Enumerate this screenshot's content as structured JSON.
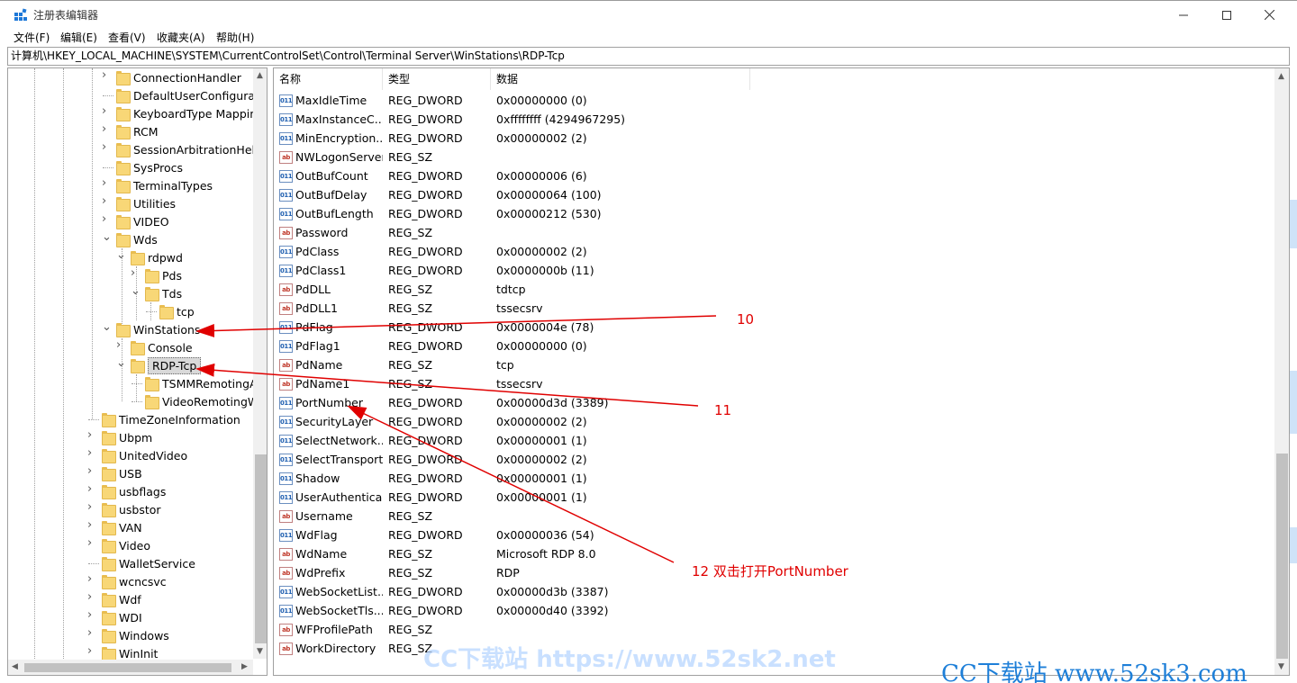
{
  "window": {
    "title": "注册表编辑器",
    "minimize_icon": "minimize-icon",
    "maximize_icon": "maximize-icon",
    "close_icon": "close-icon"
  },
  "menu": {
    "file": "文件(F)",
    "edit": "编辑(E)",
    "view": "查看(V)",
    "favorites": "收藏夹(A)",
    "help": "帮助(H)"
  },
  "address": "计算机\\HKEY_LOCAL_MACHINE\\SYSTEM\\CurrentControlSet\\Control\\Terminal Server\\WinStations\\RDP-Tcp",
  "tree": {
    "items": [
      {
        "label": "ConnectionHandler"
      },
      {
        "label": "DefaultUserConfiguration"
      },
      {
        "label": "KeyboardType Mapping"
      },
      {
        "label": "RCM"
      },
      {
        "label": "SessionArbitrationHelper"
      },
      {
        "label": "SysProcs"
      },
      {
        "label": "TerminalTypes"
      },
      {
        "label": "Utilities"
      },
      {
        "label": "VIDEO"
      },
      {
        "label": "Wds"
      },
      {
        "label": "rdpwd"
      },
      {
        "label": "Pds"
      },
      {
        "label": "Tds"
      },
      {
        "label": "tcp"
      },
      {
        "label": "WinStations"
      },
      {
        "label": "Console"
      },
      {
        "label": "RDP-Tcp"
      },
      {
        "label": "TSMMRemotingAllowedApps"
      },
      {
        "label": "VideoRemotingWindowNames"
      },
      {
        "label": "TimeZoneInformation"
      },
      {
        "label": "Ubpm"
      },
      {
        "label": "UnitedVideo"
      },
      {
        "label": "USB"
      },
      {
        "label": "usbflags"
      },
      {
        "label": "usbstor"
      },
      {
        "label": "VAN"
      },
      {
        "label": "Video"
      },
      {
        "label": "WalletService"
      },
      {
        "label": "wcncsvc"
      },
      {
        "label": "Wdf"
      },
      {
        "label": "WDI"
      },
      {
        "label": "Windows"
      },
      {
        "label": "WinInit"
      }
    ]
  },
  "list": {
    "headers": {
      "name": "名称",
      "type": "类型",
      "data": "数据"
    },
    "rows": [
      {
        "icon": "dword",
        "name": "MaxIdleTime",
        "type": "REG_DWORD",
        "data": "0x00000000 (0)"
      },
      {
        "icon": "dword",
        "name": "MaxInstanceC...",
        "type": "REG_DWORD",
        "data": "0xffffffff (4294967295)"
      },
      {
        "icon": "dword",
        "name": "MinEncryption...",
        "type": "REG_DWORD",
        "data": "0x00000002 (2)"
      },
      {
        "icon": "sz",
        "name": "NWLogonServer",
        "type": "REG_SZ",
        "data": ""
      },
      {
        "icon": "dword",
        "name": "OutBufCount",
        "type": "REG_DWORD",
        "data": "0x00000006 (6)"
      },
      {
        "icon": "dword",
        "name": "OutBufDelay",
        "type": "REG_DWORD",
        "data": "0x00000064 (100)"
      },
      {
        "icon": "dword",
        "name": "OutBufLength",
        "type": "REG_DWORD",
        "data": "0x00000212 (530)"
      },
      {
        "icon": "sz",
        "name": "Password",
        "type": "REG_SZ",
        "data": ""
      },
      {
        "icon": "dword",
        "name": "PdClass",
        "type": "REG_DWORD",
        "data": "0x00000002 (2)"
      },
      {
        "icon": "dword",
        "name": "PdClass1",
        "type": "REG_DWORD",
        "data": "0x0000000b (11)"
      },
      {
        "icon": "sz",
        "name": "PdDLL",
        "type": "REG_SZ",
        "data": "tdtcp"
      },
      {
        "icon": "sz",
        "name": "PdDLL1",
        "type": "REG_SZ",
        "data": "tssecsrv"
      },
      {
        "icon": "dword",
        "name": "PdFlag",
        "type": "REG_DWORD",
        "data": "0x0000004e (78)"
      },
      {
        "icon": "dword",
        "name": "PdFlag1",
        "type": "REG_DWORD",
        "data": "0x00000000 (0)"
      },
      {
        "icon": "sz",
        "name": "PdName",
        "type": "REG_SZ",
        "data": "tcp"
      },
      {
        "icon": "sz",
        "name": "PdName1",
        "type": "REG_SZ",
        "data": "tssecsrv"
      },
      {
        "icon": "dword",
        "name": "PortNumber",
        "type": "REG_DWORD",
        "data": "0x00000d3d (3389)"
      },
      {
        "icon": "dword",
        "name": "SecurityLayer",
        "type": "REG_DWORD",
        "data": "0x00000002 (2)"
      },
      {
        "icon": "dword",
        "name": "SelectNetwork...",
        "type": "REG_DWORD",
        "data": "0x00000001 (1)"
      },
      {
        "icon": "dword",
        "name": "SelectTransport",
        "type": "REG_DWORD",
        "data": "0x00000002 (2)"
      },
      {
        "icon": "dword",
        "name": "Shadow",
        "type": "REG_DWORD",
        "data": "0x00000001 (1)"
      },
      {
        "icon": "dword",
        "name": "UserAuthentica...",
        "type": "REG_DWORD",
        "data": "0x00000001 (1)"
      },
      {
        "icon": "sz",
        "name": "Username",
        "type": "REG_SZ",
        "data": ""
      },
      {
        "icon": "dword",
        "name": "WdFlag",
        "type": "REG_DWORD",
        "data": "0x00000036 (54)"
      },
      {
        "icon": "sz",
        "name": "WdName",
        "type": "REG_SZ",
        "data": "Microsoft RDP 8.0"
      },
      {
        "icon": "sz",
        "name": "WdPrefix",
        "type": "REG_SZ",
        "data": "RDP"
      },
      {
        "icon": "dword",
        "name": "WebSocketList...",
        "type": "REG_DWORD",
        "data": "0x00000d3b (3387)"
      },
      {
        "icon": "dword",
        "name": "WebSocketTls...",
        "type": "REG_DWORD",
        "data": "0x00000d40 (3392)"
      },
      {
        "icon": "sz",
        "name": "WFProfilePath",
        "type": "REG_SZ",
        "data": ""
      },
      {
        "icon": "sz",
        "name": "WorkDirectory",
        "type": "REG_SZ",
        "data": ""
      }
    ]
  },
  "annotations": {
    "note10": "10",
    "note11": "11",
    "note12": "12  双击打开PortNumber",
    "arrow_color": "#e00000"
  },
  "watermarks": {
    "wm1": "CC下载站 https://www.52sk2.net",
    "wm2": "CC下载站 www.52sk3.com"
  },
  "icon_names": {
    "dword": "binary-value-icon",
    "sz": "string-value-icon",
    "folder": "folder-icon",
    "app": "regedit-icon"
  }
}
